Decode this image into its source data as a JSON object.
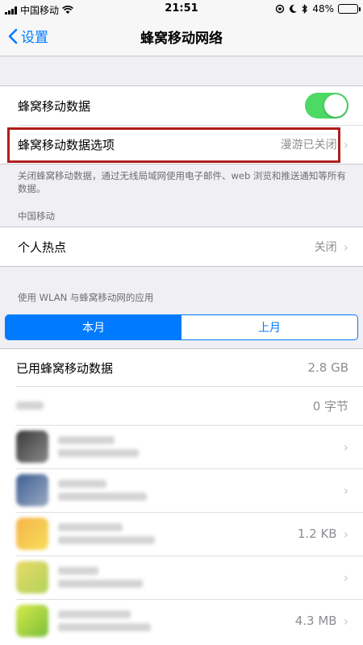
{
  "status_bar": {
    "carrier": "中国移动",
    "time": "21:51",
    "battery": "48%",
    "battery_level": 0.48
  },
  "nav": {
    "back_label": "设置",
    "title": "蜂窝移动网络"
  },
  "group1": {
    "cellular_data_label": "蜂窝移动数据",
    "cellular_data_on": true,
    "options_label": "蜂窝移动数据选项",
    "options_value": "漫游已关闭"
  },
  "footnote": "关闭蜂窝移动数据，通过无线局域网使用电子邮件、web 浏览和推送通知等所有数据。",
  "carrier_section": "中国移动",
  "hotspot": {
    "label": "个人热点",
    "value": "关闭"
  },
  "apps_section": "使用 WLAN 与蜂窝移动网的应用",
  "segments": [
    "本月",
    "上月"
  ],
  "usage": {
    "label": "已用蜂窝移动数据",
    "value": "2.8 GB"
  },
  "roaming_row": {
    "value": "0 字节"
  },
  "app_values": [
    "",
    "",
    "1.2 KB",
    "",
    "4.3 MB"
  ],
  "colors": {
    "accent": "#007aff",
    "switch_on": "#4cd964",
    "highlight": "#b01e1e"
  }
}
